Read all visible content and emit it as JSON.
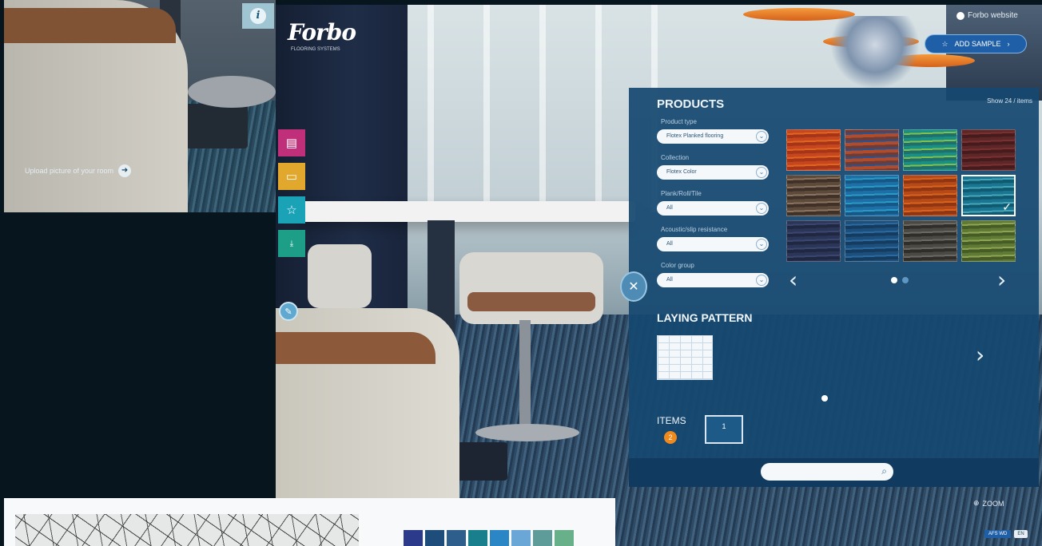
{
  "top_left_thumbnail": {
    "caption": "Upload picture of your room"
  },
  "brand": {
    "logo": "Forbo",
    "tagline": "FLOORING SYSTEMS"
  },
  "top_right": {
    "site_link": "Forbo website",
    "add_sample": "ADD SAMPLE"
  },
  "products": {
    "title": "PRODUCTS",
    "count": "Show 24 / items",
    "filters": [
      {
        "label": "Product type",
        "value": "Flotex Planked flooring"
      },
      {
        "label": "Collection",
        "value": "Flotex Color"
      },
      {
        "label": "Plank/Roll/Tile",
        "value": "All"
      },
      {
        "label": "Acoustic/slip resistance",
        "value": "All"
      },
      {
        "label": "Color group",
        "value": "All"
      }
    ],
    "swatches": [
      {
        "colors": [
          "#c6471f",
          "#e0651f",
          "#a63419"
        ]
      },
      {
        "colors": [
          "#6c3c3a",
          "#27538f",
          "#b24b2a"
        ]
      },
      {
        "colors": [
          "#1a8f86",
          "#7fbf4d",
          "#1f6f6b"
        ]
      },
      {
        "colors": [
          "#5d2627",
          "#7a3030",
          "#461b1d"
        ]
      },
      {
        "colors": [
          "#5d4a3b",
          "#8a7461",
          "#3f3127"
        ]
      },
      {
        "colors": [
          "#1e6fa6",
          "#2a9ac4",
          "#155887"
        ]
      },
      {
        "colors": [
          "#b54a18",
          "#d8621f",
          "#8f3511"
        ]
      },
      {
        "colors": [
          "#1a7690",
          "#46a5b8",
          "#0f5a70"
        ],
        "selected": true
      },
      {
        "colors": [
          "#2b3557",
          "#3a4670",
          "#1f2741"
        ]
      },
      {
        "colors": [
          "#1d4f7c",
          "#2b6aa0",
          "#153b5e"
        ]
      },
      {
        "colors": [
          "#4a4944",
          "#6a6862",
          "#2f2e2a"
        ]
      },
      {
        "colors": [
          "#5f7a35",
          "#8ea453",
          "#465c26"
        ]
      }
    ],
    "pager": {
      "pages": 2,
      "current": 1
    },
    "laying_pattern": {
      "title": "LAYING PATTERN"
    },
    "items": {
      "label": "ITEMS",
      "count": "2",
      "thumb_label": "1"
    },
    "search": {
      "placeholder": ""
    }
  },
  "zoom": {
    "label": "ZOOM"
  },
  "bottom_badge": {
    "left": "AFS WD",
    "right": "EN"
  },
  "palette": [
    "#2c3a8c",
    "#1f4d7b",
    "#2e5e8c",
    "#1a7f8d",
    "#2a86c4",
    "#6aa7d6",
    "#5e9c9a",
    "#68b08a"
  ],
  "icons": {
    "info": "info-icon",
    "tools": [
      "document-icon",
      "folder-icon",
      "star-icon",
      "download-icon"
    ],
    "edit": "pencil-icon",
    "close": "close-icon",
    "search": "search-icon",
    "zoom": "zoom-icon"
  }
}
